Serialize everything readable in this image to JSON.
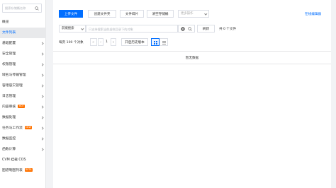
{
  "sidebar": {
    "search_placeholder": "搜索存储桶名称",
    "items": [
      {
        "label": "概览",
        "active": false,
        "expandable": false,
        "badge": ""
      },
      {
        "label": "文件列表",
        "active": true,
        "expandable": false,
        "badge": ""
      },
      {
        "label": "基础配置",
        "active": false,
        "expandable": true,
        "badge": ""
      },
      {
        "label": "安全管理",
        "active": false,
        "expandable": true,
        "badge": ""
      },
      {
        "label": "权限管理",
        "active": false,
        "expandable": true,
        "badge": ""
      },
      {
        "label": "域名与传输管理",
        "active": false,
        "expandable": true,
        "badge": ""
      },
      {
        "label": "容错容灾管理",
        "active": false,
        "expandable": true,
        "badge": ""
      },
      {
        "label": "日志管理",
        "active": false,
        "expandable": true,
        "badge": ""
      },
      {
        "label": "内容审核",
        "active": false,
        "expandable": true,
        "badge": "HOT"
      },
      {
        "label": "数据处理",
        "active": false,
        "expandable": true,
        "badge": ""
      },
      {
        "label": "任务与工作流",
        "active": false,
        "expandable": true,
        "badge": "NEW"
      },
      {
        "label": "数据监控",
        "active": false,
        "expandable": true,
        "badge": ""
      },
      {
        "label": "函数计算",
        "active": false,
        "expandable": true,
        "badge": ""
      },
      {
        "label": "CVM 挂载 COS",
        "active": false,
        "expandable": false,
        "badge": ""
      },
      {
        "label": "图谱制图列表",
        "active": false,
        "expandable": false,
        "badge": "BETA"
      }
    ]
  },
  "toolbar": {
    "upload_label": "上传文件",
    "create_folder_label": "创建文件夹",
    "fragments_label": "文件碎片",
    "clear_bucket_label": "清空存储桶",
    "more_actions_placeholder": "更多操作",
    "online_editor_link": "在线编辑器"
  },
  "search": {
    "mode_label": "前缀搜索",
    "placeholder": "只支持搜索当前虚拟目录下的对象",
    "refresh_label": "刷新",
    "file_count": "共 0 个文件"
  },
  "pagination": {
    "per_page_label": "每页 100 个对象",
    "page_number": "1",
    "versions_label": "开启历史版本"
  },
  "empty_text": "暂无数据",
  "colors": {
    "primary": "#006eff",
    "badge": "#ff7200",
    "sidebar_active_bg": "#e8e9eb"
  }
}
